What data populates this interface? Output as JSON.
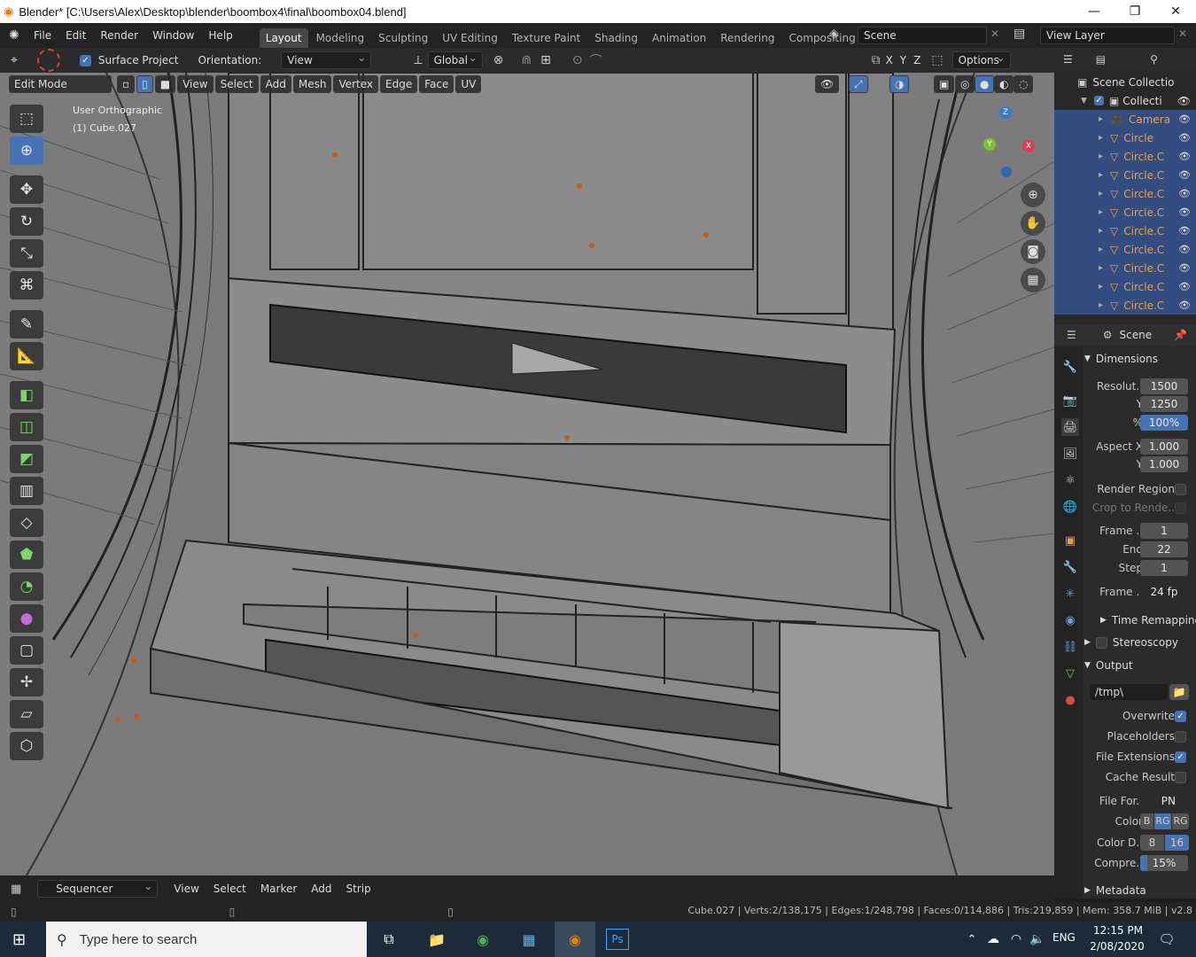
{
  "window": {
    "title": "Blender* [C:\\Users\\Alex\\Desktop\\blender\\boombox4\\final\\boombox04.blend]",
    "minimize": "—",
    "maximize": "❐",
    "close": "✕"
  },
  "menu": {
    "items": [
      "File",
      "Edit",
      "Render",
      "Window",
      "Help"
    ],
    "workspaces": [
      "Layout",
      "Modeling",
      "Sculpting",
      "UV Editing",
      "Texture Paint",
      "Shading",
      "Animation",
      "Rendering",
      "Compositing"
    ],
    "active_workspace": "Layout",
    "scene": "Scene",
    "view_layer": "View Layer"
  },
  "tool_header": {
    "surface_project": "Surface Project",
    "orientation_label": "Orientation:",
    "orientation_value": "View",
    "transform_space": "Global",
    "axes": [
      "X",
      "Y",
      "Z"
    ],
    "options": "Options"
  },
  "viewport": {
    "mode": "Edit Mode",
    "menus": [
      "View",
      "Select",
      "Add",
      "Mesh",
      "Vertex",
      "Edge",
      "Face",
      "UV"
    ],
    "view_name": "User Orthographic",
    "object_name": "(1) Cube.027",
    "gizmo_axes": {
      "x": "X",
      "y": "Y",
      "z": "Z"
    }
  },
  "outliner": {
    "root": "Scene Collectio",
    "collection": "Collecti",
    "items": [
      "Camera",
      "Circle",
      "Circle.C",
      "Circle.C",
      "Circle.C",
      "Circle.C",
      "Circle.C",
      "Circle.C",
      "Circle.C",
      "Circle.C",
      "Circle.C"
    ]
  },
  "properties": {
    "scene_label": "Scene",
    "dimensions_header": "Dimensions",
    "resolution_x_label": "Resolut..",
    "resolution_x": "1500",
    "resolution_y_label": "Y",
    "resolution_y": "1250",
    "percent_label": "%",
    "percent": "100%",
    "aspect_x_label": "Aspect X",
    "aspect_x": "1.000",
    "aspect_y_label": "Y",
    "aspect_y": "1.000",
    "render_region": "Render Region",
    "crop_to_render": "Crop to Rende..",
    "frame_start_label": "Frame ..",
    "frame_start": "1",
    "frame_end_label": "End",
    "frame_end": "22",
    "frame_step_label": "Step",
    "frame_step": "1",
    "frame_rate_label": "Frame ..",
    "frame_rate": "24 fp",
    "time_remapping": "Time Remapping",
    "stereoscopy": "Stereoscopy",
    "output_header": "Output",
    "output_path": "/tmp\\",
    "overwrite": "Overwrite",
    "placeholders": "Placeholders",
    "file_extensions": "File Extensions",
    "cache_result": "Cache Result",
    "file_format_label": "File For..",
    "file_format": "PN",
    "color_label": "Color",
    "color_options": [
      "B",
      "RG",
      "RG"
    ],
    "color_depth_label": "Color D..",
    "color_depth_options": [
      "8",
      "16"
    ],
    "compression_label": "Compre..",
    "compression": "15%",
    "metadata_header": "Metadata"
  },
  "timeline": {
    "editor": "Sequencer",
    "menus": [
      "View",
      "Select",
      "Marker",
      "Add",
      "Strip"
    ]
  },
  "status": {
    "text": "Cube.027 | Verts:2/138,175 | Edges:1/248,798 | Faces:0/114,886 | Tris:219,859 | Mem: 358.7 MiB | v2.8"
  },
  "taskbar": {
    "search_placeholder": "Type here to search",
    "lang": "ENG",
    "time": "12:15 PM",
    "date": "2/08/2020"
  }
}
